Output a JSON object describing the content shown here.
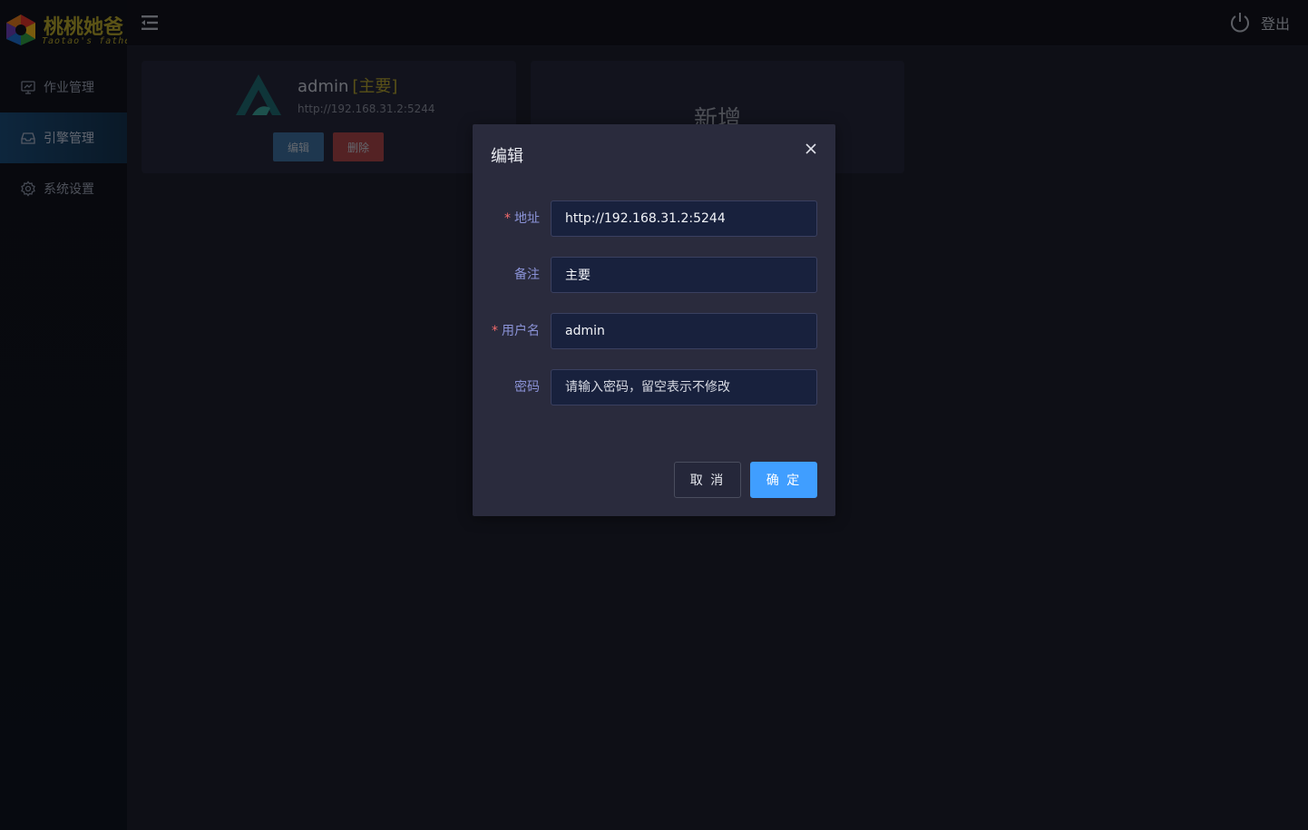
{
  "brand": {
    "title": "桃桃她爸",
    "subtitle": "Taotao's father"
  },
  "sidebar": {
    "items": [
      {
        "label": "作业管理",
        "icon": "monitor-icon",
        "active": false
      },
      {
        "label": "引擎管理",
        "icon": "inbox-icon",
        "active": true
      },
      {
        "label": "系统设置",
        "icon": "gear-icon",
        "active": false
      }
    ]
  },
  "header": {
    "logout_label": "登出"
  },
  "engine_card": {
    "name": "admin",
    "tag": "[主要]",
    "url": "http://192.168.31.2:5244",
    "edit_label": "编辑",
    "delete_label": "删除"
  },
  "add_card": {
    "label": "新增"
  },
  "dialog": {
    "title": "编辑",
    "fields": {
      "address": {
        "label": "地址",
        "required": true,
        "value": "http://192.168.31.2:5244"
      },
      "remark": {
        "label": "备注",
        "required": false,
        "value": "主要"
      },
      "username": {
        "label": "用户名",
        "required": true,
        "value": "admin"
      },
      "password": {
        "label": "密码",
        "required": false,
        "value": "",
        "placeholder": "请输入密码，留空表示不修改"
      }
    },
    "cancel_label": "取 消",
    "confirm_label": "确 定"
  },
  "colors": {
    "accent": "#409eff",
    "danger": "#a84548",
    "brand": "#b7a62c"
  }
}
